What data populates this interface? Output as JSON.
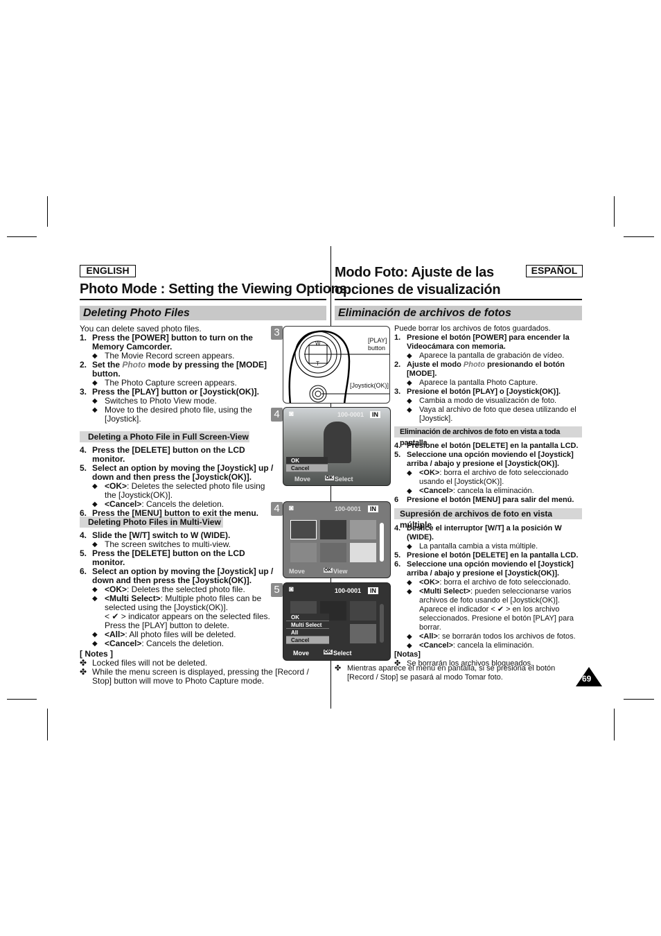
{
  "header": {
    "english_label": "ENGLISH",
    "espanol_label": "ESPAÑOL",
    "title_en": "Photo Mode : Setting the Viewing Options",
    "title_es_1": "Modo Foto: Ajuste de las",
    "title_es_2": "opciones de visualización"
  },
  "sections": {
    "en": "Deleting Photo Files",
    "es": "Eliminación de archivos de fotos"
  },
  "subheads": {
    "en_full": "Deleting a Photo File in Full Screen-View",
    "en_multi": "Deleting Photo Files in Multi-View",
    "es_full": "Eliminación de archivos de foto en vista a toda pantalla",
    "es_multi": "Supresión de archivos de foto en vista múltiple"
  },
  "blocks": {
    "en1": [
      {
        "type": "para",
        "seg": [
          {
            "t": "You can delete saved photo files."
          }
        ]
      },
      {
        "type": "step",
        "num": "1.",
        "seg": [
          {
            "t": "Press the [POWER] button to turn on the Memory Camcorder."
          }
        ]
      },
      {
        "type": "bullet",
        "num": "◆",
        "seg": [
          {
            "t": "The Movie Record screen appears."
          }
        ]
      },
      {
        "type": "step",
        "num": "2.",
        "seg": [
          {
            "t": "Set the "
          },
          {
            "t": "Photo",
            "c": "i"
          },
          {
            "t": " mode by pressing the [MODE] button."
          }
        ]
      },
      {
        "type": "bullet",
        "num": "◆",
        "seg": [
          {
            "t": "The Photo Capture screen appears."
          }
        ]
      },
      {
        "type": "step",
        "num": "3.",
        "seg": [
          {
            "t": "Press the  [PLAY] button or [Joystick(OK)]."
          }
        ]
      },
      {
        "type": "bullet",
        "num": "◆",
        "seg": [
          {
            "t": "Switches to Photo View mode."
          }
        ]
      },
      {
        "type": "bullet",
        "num": "◆",
        "seg": [
          {
            "t": "Move to the desired photo file, using the [Joystick]."
          }
        ]
      }
    ],
    "en2": [
      {
        "type": "step",
        "num": "4.",
        "seg": [
          {
            "t": "Press the [DELETE] button on the LCD monitor."
          }
        ]
      },
      {
        "type": "step",
        "num": "5.",
        "seg": [
          {
            "t": "Select an option by moving the [Joystick] up / down and then press the [Joystick(OK)]."
          }
        ]
      },
      {
        "type": "bullet",
        "num": "◆",
        "seg": [
          {
            "t": "<OK>",
            "c": "b"
          },
          {
            "t": ": Deletes the selected photo file using the [Joystick(OK)]."
          }
        ]
      },
      {
        "type": "bullet",
        "num": "◆",
        "seg": [
          {
            "t": "<Cancel>",
            "c": "b"
          },
          {
            "t": ": Cancels the deletion."
          }
        ]
      },
      {
        "type": "step",
        "num": "6.",
        "seg": [
          {
            "t": "Press the [MENU] button to exit the menu."
          }
        ]
      }
    ],
    "en3": [
      {
        "type": "step",
        "num": "4.",
        "seg": [
          {
            "t": "Slide the [W/T] switch to W (WIDE)."
          }
        ]
      },
      {
        "type": "bullet",
        "num": "◆",
        "seg": [
          {
            "t": "The screen switches to multi-view."
          }
        ]
      },
      {
        "type": "step",
        "num": "5.",
        "seg": [
          {
            "t": "Press the [DELETE] button on the LCD monitor."
          }
        ]
      },
      {
        "type": "step",
        "num": "6.",
        "seg": [
          {
            "t": "Select an option by moving the [Joystick] up / down and then press the [Joystick(OK)]."
          }
        ]
      },
      {
        "type": "bullet",
        "num": "◆",
        "seg": [
          {
            "t": "<OK>",
            "c": "b"
          },
          {
            "t": ": Deletes the selected photo file."
          }
        ]
      },
      {
        "type": "bullet",
        "num": "◆",
        "seg": [
          {
            "t": "<Multi Select>",
            "c": "b"
          },
          {
            "t": ": Multiple photo files can be selected using the [Joystick(OK)]."
          }
        ]
      },
      {
        "type": "plain",
        "seg": [
          {
            "t": "< ✔ > indicator appears on the selected files. Press the [PLAY] button to delete."
          }
        ]
      },
      {
        "type": "bullet",
        "num": "◆",
        "seg": [
          {
            "t": "<All>",
            "c": "b"
          },
          {
            "t": ": All photo files will be deleted."
          }
        ]
      },
      {
        "type": "bullet",
        "num": "◆",
        "seg": [
          {
            "t": "<Cancel>",
            "c": "b"
          },
          {
            "t": ": Cancels the deletion."
          }
        ]
      }
    ],
    "en4": [
      {
        "type": "head",
        "seg": [
          {
            "t": "[ Notes ]"
          }
        ]
      },
      {
        "type": "note",
        "num": "✤",
        "seg": [
          {
            "t": "Locked files will not be deleted."
          }
        ]
      },
      {
        "type": "note",
        "num": "✤",
        "seg": [
          {
            "t": "While the menu screen is displayed, pressing the [Record / Stop] button will move to Photo Capture mode."
          }
        ]
      }
    ],
    "es1": [
      {
        "type": "para",
        "seg": [
          {
            "t": "Puede borrar los archivos de fotos guardados."
          }
        ]
      },
      {
        "type": "step",
        "num": "1.",
        "seg": [
          {
            "t": "Presione el botón [POWER] para encender la Videocámara con memoria."
          }
        ]
      },
      {
        "type": "bullet",
        "num": "◆",
        "seg": [
          {
            "t": "Aparece la pantalla de grabación de vídeo."
          }
        ]
      },
      {
        "type": "step",
        "num": "2.",
        "seg": [
          {
            "t": "Ajuste el modo "
          },
          {
            "t": "Photo",
            "c": "i"
          },
          {
            "t": " presionando el botón [MODE]."
          }
        ]
      },
      {
        "type": "bullet",
        "num": "◆",
        "seg": [
          {
            "t": "Aparece la pantalla Photo Capture."
          }
        ]
      },
      {
        "type": "step",
        "num": "3.",
        "seg": [
          {
            "t": "Presione el botón [PLAY] o [Joystick(OK)]."
          }
        ]
      },
      {
        "type": "bullet",
        "num": "◆",
        "seg": [
          {
            "t": "Cambia a modo de visualización de foto."
          }
        ]
      },
      {
        "type": "bullet",
        "num": "◆",
        "seg": [
          {
            "t": "Vaya al archivo de foto que desea utilizando el [Joystick]."
          }
        ]
      }
    ],
    "es2": [
      {
        "type": "step",
        "num": "4.",
        "seg": [
          {
            "t": "Presione el botón [DELETE] en la pantalla LCD."
          }
        ]
      },
      {
        "type": "step",
        "num": "5.",
        "seg": [
          {
            "t": "Seleccione una opción moviendo el [Joystick] arriba / abajo y presione el [Joystick(OK)]."
          }
        ]
      },
      {
        "type": "bullet",
        "num": "◆",
        "seg": [
          {
            "t": "<OK>",
            "c": "b"
          },
          {
            "t": ": borra el archivo de foto seleccionado usando el [Joystick(OK)]."
          }
        ]
      },
      {
        "type": "bullet",
        "num": "◆",
        "seg": [
          {
            "t": "<Cancel>",
            "c": "b"
          },
          {
            "t": ": cancela la eliminación."
          }
        ]
      },
      {
        "type": "step",
        "num": "6",
        "seg": [
          {
            "t": "Presione el botón [MENU] para salir del menú."
          }
        ]
      }
    ],
    "es3": [
      {
        "type": "step",
        "num": "4.",
        "seg": [
          {
            "t": "Deslice el interruptor [W/T] a la posición W (WIDE)."
          }
        ]
      },
      {
        "type": "bullet",
        "num": "◆",
        "seg": [
          {
            "t": "La pantalla cambia a vista múltiple."
          }
        ]
      },
      {
        "type": "step",
        "num": "5.",
        "seg": [
          {
            "t": "Presione el botón [DELETE] en la pantalla LCD."
          }
        ]
      },
      {
        "type": "step",
        "num": "6.",
        "seg": [
          {
            "t": "Seleccione una opción moviendo el [Joystick] arriba / abajo y presione el [Joystick(OK)]."
          }
        ]
      },
      {
        "type": "bullet",
        "num": "◆",
        "seg": [
          {
            "t": "<OK>",
            "c": "b"
          },
          {
            "t": ": borra el archivo de foto seleccionado."
          }
        ]
      },
      {
        "type": "bullet",
        "num": "◆",
        "seg": [
          {
            "t": "<Multi Select>",
            "c": "b"
          },
          {
            "t": ": pueden seleccionarse varios archivos de foto usando el [Joystick(OK)]."
          }
        ]
      },
      {
        "type": "plain",
        "seg": [
          {
            "t": "Aparece el indicador < ✔ > en los archivo seleccionados. Presione el botón [PLAY] para borrar."
          }
        ]
      },
      {
        "type": "bullet",
        "num": "◆",
        "seg": [
          {
            "t": "<All>",
            "c": "b"
          },
          {
            "t": ": se borrarán todos los archivos de fotos."
          }
        ]
      },
      {
        "type": "bullet",
        "num": "◆",
        "seg": [
          {
            "t": "<Cancel>",
            "c": "b"
          },
          {
            "t": ": cancela la eliminación."
          }
        ]
      },
      {
        "type": "head",
        "seg": [
          {
            "t": "[Notas]"
          }
        ]
      },
      {
        "type": "note",
        "num": "✤",
        "seg": [
          {
            "t": "Se borrarán los archivos bloqueados."
          }
        ]
      }
    ],
    "es4": [
      {
        "type": "note",
        "num": "✤",
        "seg": [
          {
            "t": "Mientras aparece el menú en pantalla, si se presiona el botón [Record / Stop] se pasará al modo Tomar foto."
          }
        ]
      }
    ]
  },
  "figures": {
    "fig3": {
      "badge": "3",
      "play_label_1": "[PLAY]",
      "play_label_2": "button",
      "joystick_label": "[Joystick(OK)]",
      "w": "W",
      "t": "T",
      "play": "PLAY"
    },
    "fig4a": {
      "badge": "4",
      "file": "100-0001",
      "memory": "IN",
      "menu": [
        "OK",
        "Cancel"
      ],
      "move": "Move",
      "ok_icon": "OK",
      "select": "Select"
    },
    "fig4b": {
      "badge": "4",
      "file": "100-0001",
      "memory": "IN",
      "move": "Move",
      "ok_icon": "OK",
      "view": "View"
    },
    "fig5": {
      "badge": "5",
      "file": "100-0001",
      "memory": "IN",
      "menu": [
        "OK",
        "Multi Select",
        "All",
        "Cancel"
      ],
      "move": "Move",
      "ok_icon": "OK",
      "select": "Select"
    }
  },
  "page_number": "69"
}
